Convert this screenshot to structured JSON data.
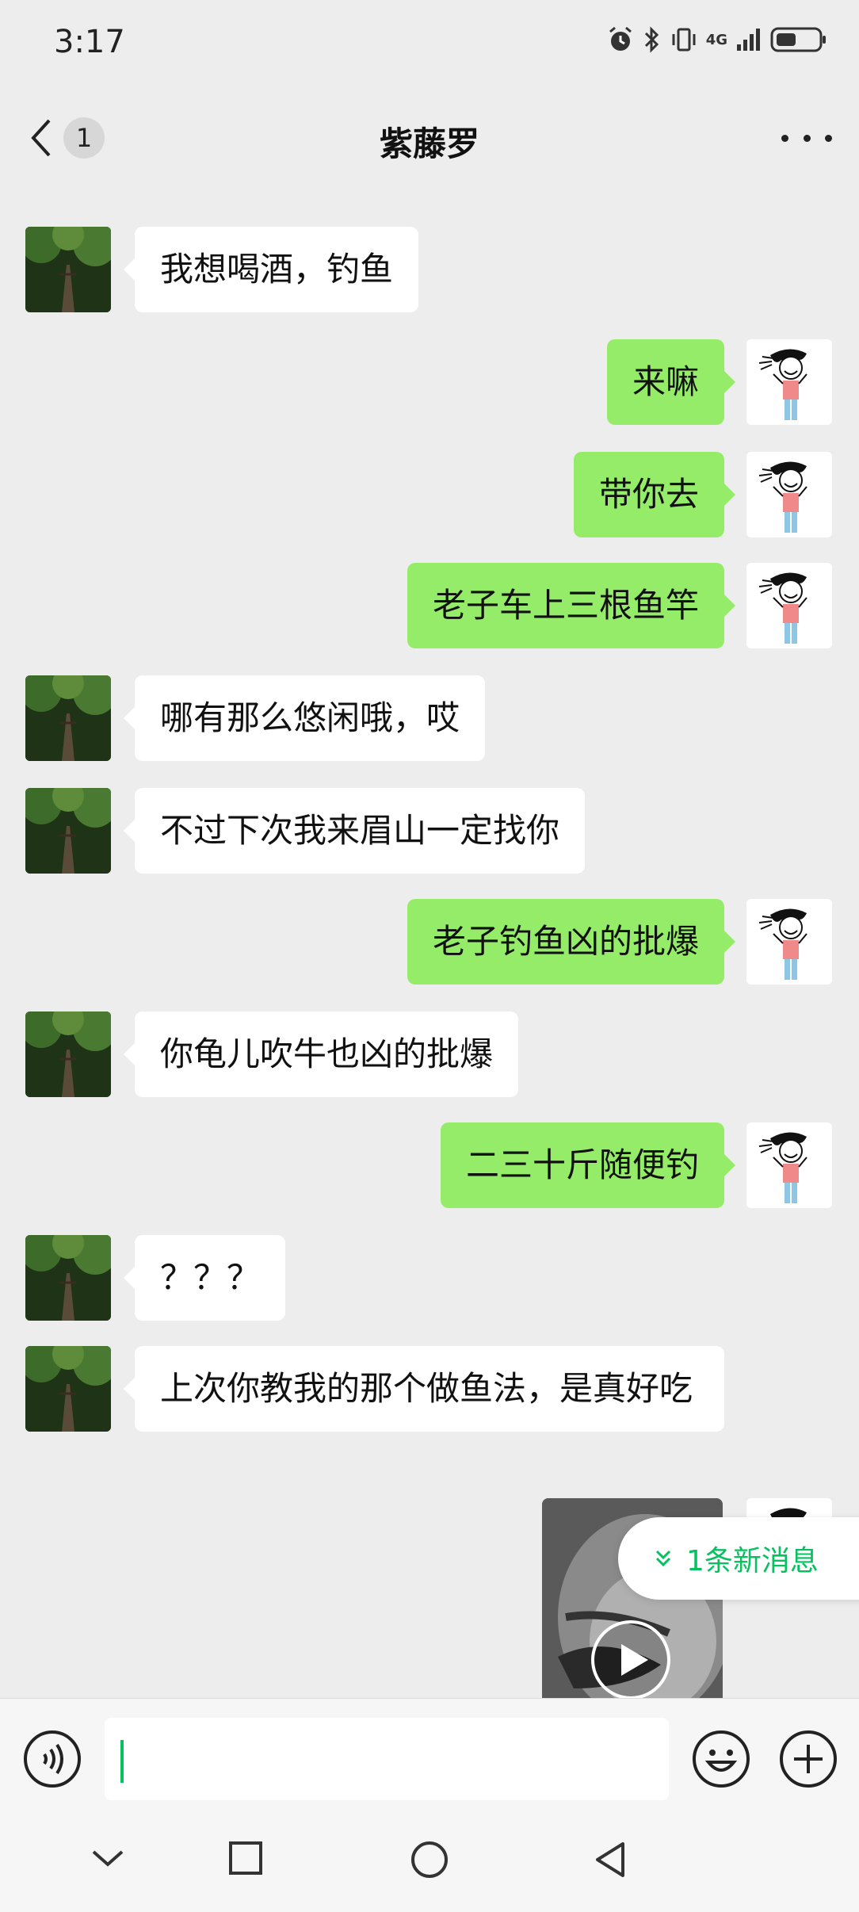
{
  "status_bar": {
    "time": "3:17",
    "network": "4G",
    "icons": [
      "alarm-icon",
      "bluetooth-icon",
      "vibrate-icon",
      "signal-icon",
      "battery-icon"
    ]
  },
  "header": {
    "back_count": "1",
    "title": "紫藤罗",
    "more_icon": "more-icon"
  },
  "messages": [
    {
      "from": "them",
      "text": "我想喝酒，钓鱼"
    },
    {
      "from": "me",
      "text": "来嘛"
    },
    {
      "from": "me",
      "text": "带你去"
    },
    {
      "from": "me",
      "text": "老子车上三根鱼竿"
    },
    {
      "from": "them",
      "text": "哪有那么悠闲哦，哎"
    },
    {
      "from": "them",
      "text": "不过下次我来眉山一定找你"
    },
    {
      "from": "me",
      "text": "老子钓鱼凶的批爆"
    },
    {
      "from": "them",
      "text": "你龟儿吹牛也凶的批爆"
    },
    {
      "from": "me",
      "text": "二三十斤随便钓"
    },
    {
      "from": "them",
      "text": "？？？"
    },
    {
      "from": "them",
      "text": "上次你教我的那个做鱼法，是真好吃"
    },
    {
      "from": "me",
      "type": "video"
    }
  ],
  "new_message_banner": "1条新消息",
  "input": {
    "value": "",
    "voice_icon": "voice-icon",
    "emoji_icon": "emoji-icon",
    "plus_icon": "plus-icon"
  },
  "nav_bar": {
    "icons": [
      "nav-down-icon",
      "recents-icon",
      "home-icon",
      "back-icon"
    ]
  },
  "colors": {
    "background": "#ededed",
    "bubble_me": "#95ec69",
    "bubble_them": "#ffffff",
    "accent": "#07c160"
  }
}
